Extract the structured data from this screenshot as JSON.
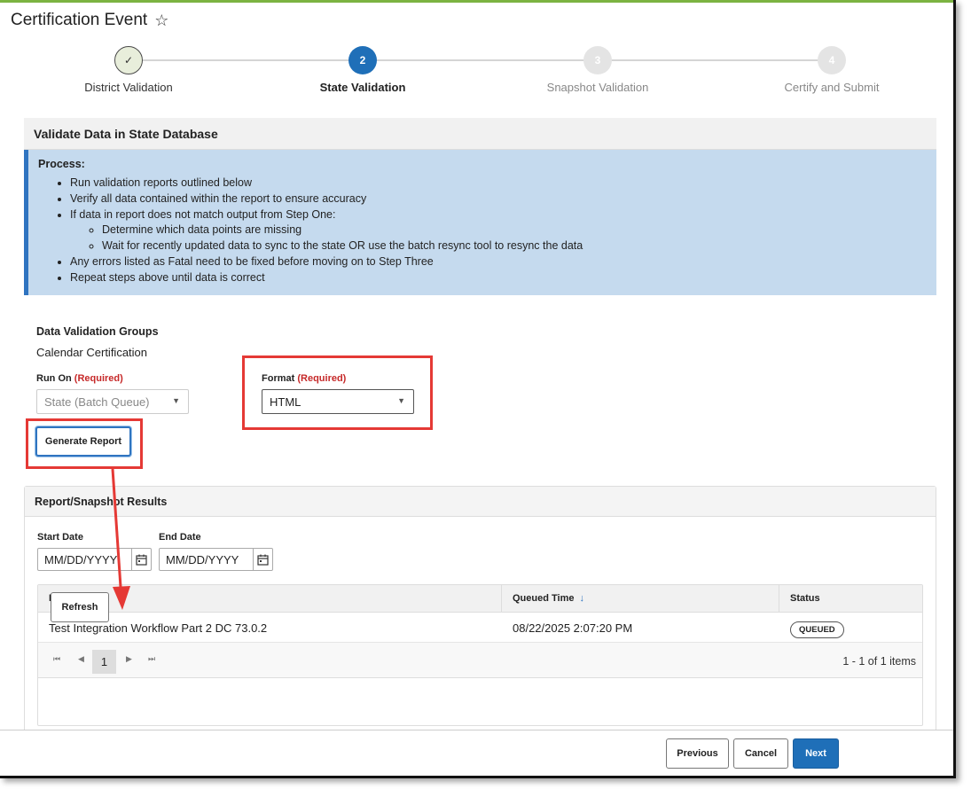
{
  "page": {
    "title": "Certification Event"
  },
  "stepper": {
    "steps": [
      {
        "number": "✓",
        "label": "District Validation",
        "state": "done"
      },
      {
        "number": "2",
        "label": "State Validation",
        "state": "active"
      },
      {
        "number": "3",
        "label": "Snapshot Validation",
        "state": "future"
      },
      {
        "number": "4",
        "label": "Certify and Submit",
        "state": "future"
      }
    ]
  },
  "panel": {
    "title": "Validate Data in State Database",
    "process_title": "Process:",
    "process_items": [
      "Run validation reports outlined below",
      "Verify all data contained within the report to ensure accuracy",
      "If data in report does not match output from Step One:",
      "Determine which data points are missing",
      "Wait for recently updated data to sync to the state OR use the batch resync tool to resync the data",
      "Any errors listed as Fatal need to be fixed before moving on to Step Three",
      "Repeat steps above until data is correct"
    ]
  },
  "dvg": {
    "title": "Data Validation Groups",
    "value": "Calendar Certification"
  },
  "run_on": {
    "label": "Run On",
    "required": "(Required)",
    "value": "State (Batch Queue)"
  },
  "format": {
    "label": "Format",
    "required": "(Required)",
    "value": "HTML"
  },
  "generate_label": "Generate Report",
  "results": {
    "title": "Report/Snapshot Results",
    "start_label": "Start Date",
    "end_label": "End Date",
    "start_placeholder": "MM/DD/YYYY",
    "end_placeholder": "MM/DD/YYYY",
    "columns": [
      "Report Title",
      "Queued Time",
      "Status"
    ],
    "rows": [
      {
        "title": "Test Integration Workflow Part 2 DC 73.0.2",
        "queued": "08/22/2025 2:07:20 PM",
        "status": "QUEUED"
      }
    ],
    "page": "1",
    "page_info": "1 - 1 of 1 items",
    "refresh_label": "Refresh"
  },
  "footer": {
    "previous": "Previous",
    "cancel": "Cancel",
    "next": "Next"
  },
  "colors": {
    "accent": "#1f6fb8",
    "highlight": "#e53935",
    "process_bg": "#c5daee"
  }
}
